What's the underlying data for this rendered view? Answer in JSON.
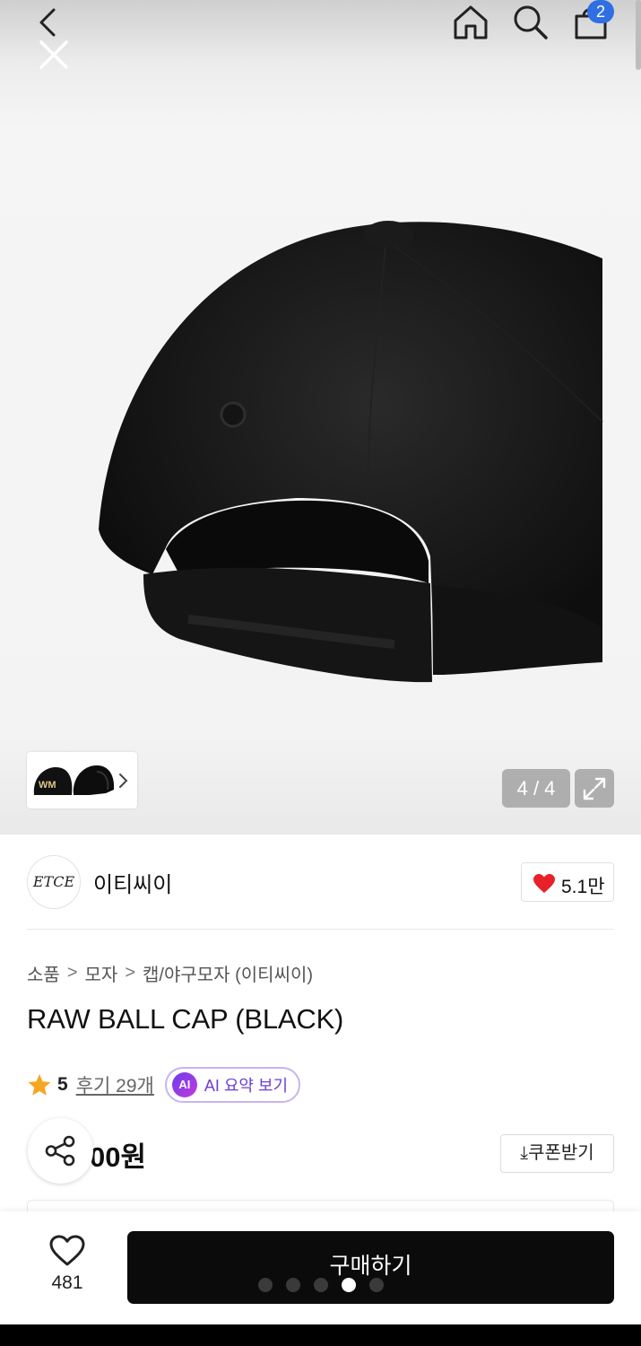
{
  "header": {
    "cart_count": "2"
  },
  "gallery": {
    "counter": "4 / 4",
    "thumbnail_text": "WM",
    "pager_dots": 5,
    "active_dot": 4
  },
  "brand": {
    "logo_text": "ETCE",
    "name": "이티씨이",
    "likes": "5.1만"
  },
  "breadcrumb": [
    "소품",
    "모자",
    "캡/야구모자 (이티씨이)"
  ],
  "product": {
    "title": "RAW BALL CAP (BLACK)",
    "rating": "5",
    "reviews_label": "후기 29개",
    "ai_badge": "AI",
    "ai_summary_label": "AI 요약 보기",
    "price_visible": "00원",
    "coupon_label": "⤓쿠폰받기"
  },
  "bottom_bar": {
    "wishlist_count": "481",
    "buy_label": "구매하기"
  },
  "colors": {
    "accent_blue": "#2f6fe3",
    "heart_red": "#e8202a",
    "star_orange": "#f5a623",
    "ai_purple": "#6b3fd6",
    "buy_button": "#0b0b0b"
  },
  "icons": [
    "back-icon",
    "close-icon",
    "home-icon",
    "search-icon",
    "cart-icon",
    "chevron-right-icon",
    "expand-icon",
    "heart-icon",
    "star-icon",
    "share-icon"
  ]
}
